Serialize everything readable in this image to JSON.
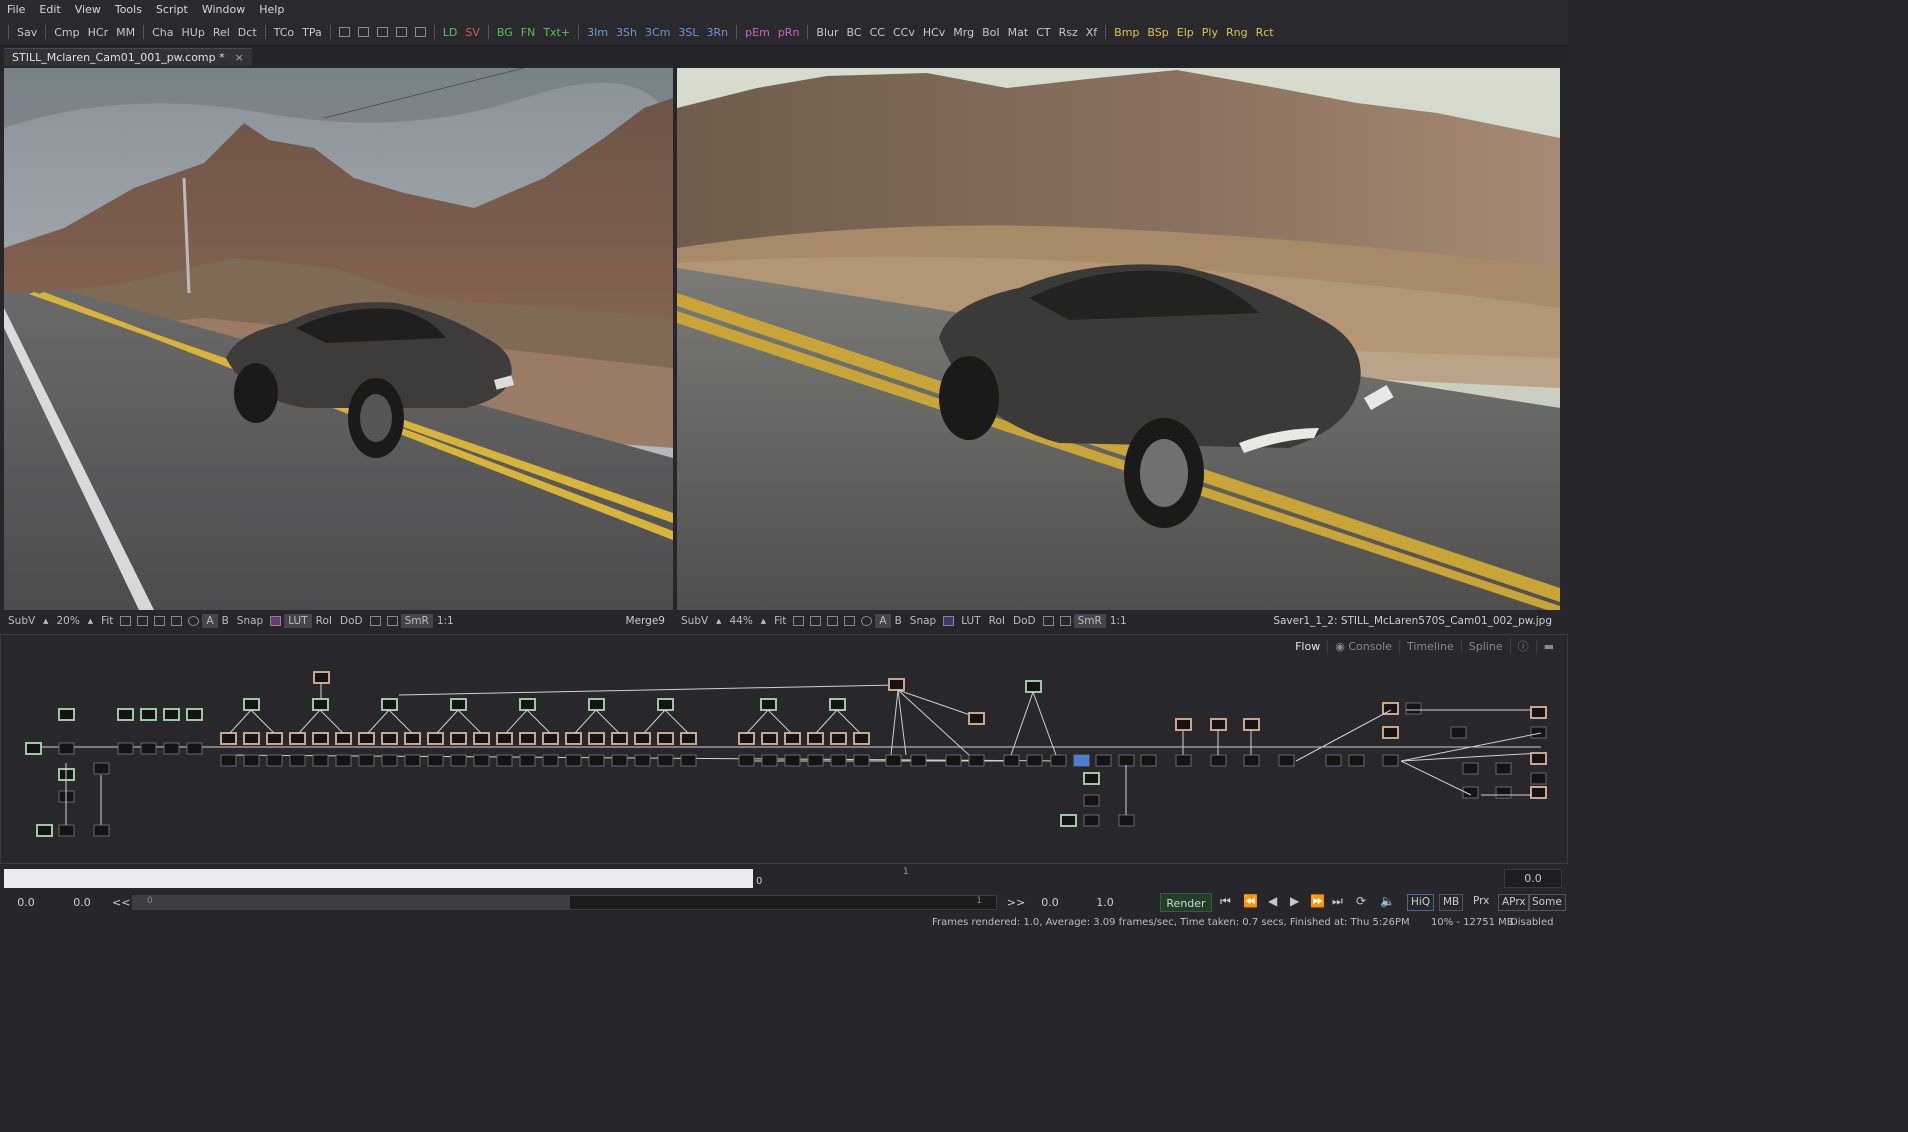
{
  "menu": [
    "File",
    "Edit",
    "View",
    "Tools",
    "Script",
    "Window",
    "Help"
  ],
  "toolbar": {
    "groups": [
      [
        {
          "t": "Sav",
          "c": "#c8c8c8"
        }
      ],
      [
        {
          "t": "Cmp",
          "c": "#c8c8c8"
        },
        {
          "t": "HCr",
          "c": "#c8c8c8"
        },
        {
          "t": "MM",
          "c": "#c8c8c8"
        }
      ],
      [
        {
          "t": "Cha",
          "c": "#c8c8c8"
        },
        {
          "t": "HUp",
          "c": "#c8c8c8"
        },
        {
          "t": "Rel",
          "c": "#c8c8c8"
        },
        {
          "t": "Dct",
          "c": "#c8c8c8"
        }
      ],
      [
        {
          "t": "TCo",
          "c": "#c8c8c8"
        },
        {
          "t": "TPa",
          "c": "#c8c8c8"
        }
      ],
      [
        {
          "t": "layout1-icon",
          "c": "icon"
        },
        {
          "t": "layout2-icon",
          "c": "icon"
        },
        {
          "t": "layout3-icon",
          "c": "icon"
        },
        {
          "t": "layout4-icon",
          "c": "icon"
        },
        {
          "t": "layout5-icon",
          "c": "icon"
        }
      ],
      [
        {
          "t": "LD",
          "c": "#5fbf5a"
        },
        {
          "t": "SV",
          "c": "#d4584a"
        }
      ],
      [
        {
          "t": "BG",
          "c": "#5fbf5a"
        },
        {
          "t": "FN",
          "c": "#5fbf5a"
        },
        {
          "t": "Txt+",
          "c": "#5fbf5a"
        }
      ],
      [
        {
          "t": "3Im",
          "c": "#6a9ad8"
        },
        {
          "t": "3Sh",
          "c": "#6a9ad8"
        },
        {
          "t": "3Cm",
          "c": "#6a9ad8"
        },
        {
          "t": "3SL",
          "c": "#6a9ad8"
        },
        {
          "t": "3Rn",
          "c": "#6a9ad8"
        }
      ],
      [
        {
          "t": "pEm",
          "c": "#d060c8"
        },
        {
          "t": "pRn",
          "c": "#d060c8"
        }
      ],
      [
        {
          "t": "Blur",
          "c": "#c8c8c8"
        },
        {
          "t": "BC",
          "c": "#c8c8c8"
        },
        {
          "t": "CC",
          "c": "#c8c8c8"
        },
        {
          "t": "CCv",
          "c": "#c8c8c8"
        },
        {
          "t": "HCv",
          "c": "#c8c8c8"
        },
        {
          "t": "Mrg",
          "c": "#c8c8c8"
        },
        {
          "t": "BoI",
          "c": "#c8c8c8"
        },
        {
          "t": "Mat",
          "c": "#c8c8c8"
        },
        {
          "t": "CT",
          "c": "#c8c8c8"
        },
        {
          "t": "Rsz",
          "c": "#c8c8c8"
        },
        {
          "t": "Xf",
          "c": "#c8c8c8"
        }
      ],
      [
        {
          "t": "Bmp",
          "c": "#e0c050"
        },
        {
          "t": "BSp",
          "c": "#e0c050"
        },
        {
          "t": "Elp",
          "c": "#e0c050"
        },
        {
          "t": "Ply",
          "c": "#e0c050"
        },
        {
          "t": "Rng",
          "c": "#e0c050"
        },
        {
          "t": "Rct",
          "c": "#e0c050"
        }
      ]
    ]
  },
  "tab": {
    "title": "STILL_Mclaren_Cam01_001_pw.comp *",
    "close": "×"
  },
  "viewer_left": {
    "subv": "SubV",
    "zoom": "20%",
    "fit": "Fit",
    "a": "A",
    "b": "B",
    "snap": "Snap",
    "lut": "LUT",
    "roi": "RoI",
    "dod": "DoD",
    "smr": "SmR",
    "ratio": "1:1",
    "title": "Merge9"
  },
  "viewer_right": {
    "subv": "SubV",
    "zoom": "44%",
    "fit": "Fit",
    "a": "A",
    "b": "B",
    "snap": "Snap",
    "lut": "LUT",
    "roi": "RoI",
    "dod": "DoD",
    "smr": "SmR",
    "ratio": "1:1",
    "title": "Saver1_1_2: STILL_McLaren570S_Cam01_002_pw.jpg"
  },
  "flow_tabs": {
    "flow": "Flow",
    "console": "Console",
    "timeline": "Timeline",
    "spline": "Spline"
  },
  "timeline": {
    "current": "0",
    "mid_marker": "1",
    "end_value": "0.0"
  },
  "transport": {
    "start": "0.0",
    "render_start": "0.0",
    "back": "<<",
    "scrub_label": "0",
    "scrub_end": "1",
    "fwd": ">>",
    "render_end": "0.0",
    "end": "1.0",
    "render": "Render",
    "hiq": "HiQ",
    "mb": "MB",
    "prx": "Prx",
    "aprx": "APrx",
    "some": "Some"
  },
  "status": {
    "text": "Frames rendered: 1.0,  Average: 3.09 frames/sec,  Time taken: 0.7 secs,  Finished at: Thu 5:26PM",
    "mem": "10% - 12751 MB",
    "state": "Disabled"
  },
  "colors": {
    "node_green": "#9ec8a0",
    "node_tan": "#c9a58a",
    "node_gray": "#6a6a6a",
    "node_dark": "#141414",
    "selected_blue": "#4a7fd4"
  }
}
